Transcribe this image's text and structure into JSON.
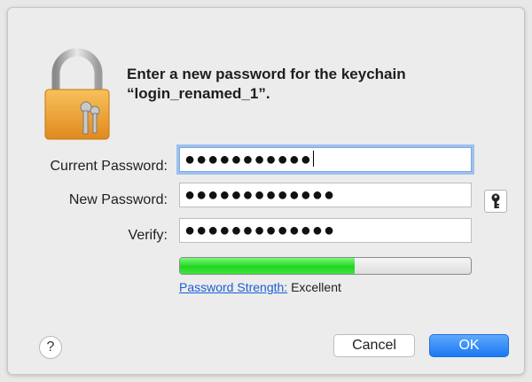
{
  "dialog": {
    "prompt_line1": "Enter a new password for the keychain",
    "prompt_line2": "“login_renamed_1”."
  },
  "fields": {
    "current_password": {
      "label": "Current Password:",
      "value": "●●●●●●●●●●●"
    },
    "new_password": {
      "label": "New Password:",
      "value": "●●●●●●●●●●●●●"
    },
    "verify": {
      "label": "Verify:",
      "value": "●●●●●●●●●●●●●"
    }
  },
  "strength": {
    "link_label": "Password Strength:",
    "rating": "Excellent",
    "level_fraction": 0.6
  },
  "buttons": {
    "help_label": "?",
    "cancel_label": "Cancel",
    "ok_label": "OK"
  },
  "colors": {
    "ok_button": "#1b78f3",
    "strength_fill": "#22d422",
    "link": "#1a5fd6",
    "lock_body": "#f0a73a"
  },
  "icons": {
    "lock": "padlock-with-keys-icon",
    "key": "key-icon"
  }
}
